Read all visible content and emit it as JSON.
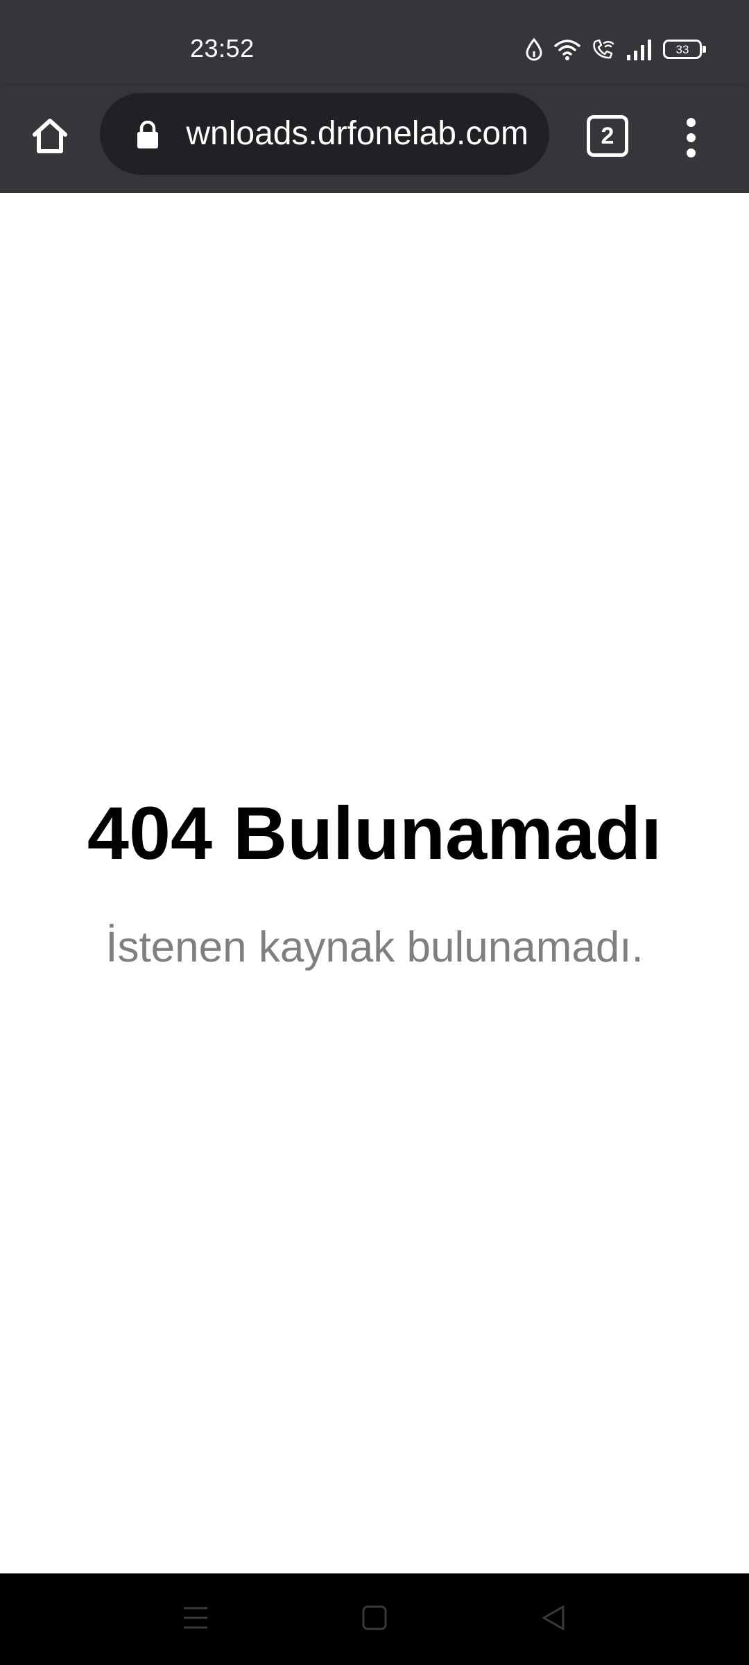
{
  "status_bar": {
    "time": "23:52",
    "battery_level": "33",
    "icons": [
      "data-saver-icon",
      "wifi-icon",
      "wifi-calling-icon",
      "signal-icon",
      "battery-icon"
    ]
  },
  "browser": {
    "url": "downloads.drfonelab.com",
    "tab_count": "2",
    "secure": true
  },
  "page": {
    "title": "404 Bulunamadı",
    "message": "İstenen kaynak bulunamadı."
  },
  "nav_bar": {
    "buttons": [
      "menu-icon",
      "home-icon",
      "back-icon"
    ]
  },
  "colors": {
    "toolbar": "#35363a",
    "omnibox": "#202124",
    "message_text": "#7f7f7f",
    "nav_bar": "#000000"
  }
}
